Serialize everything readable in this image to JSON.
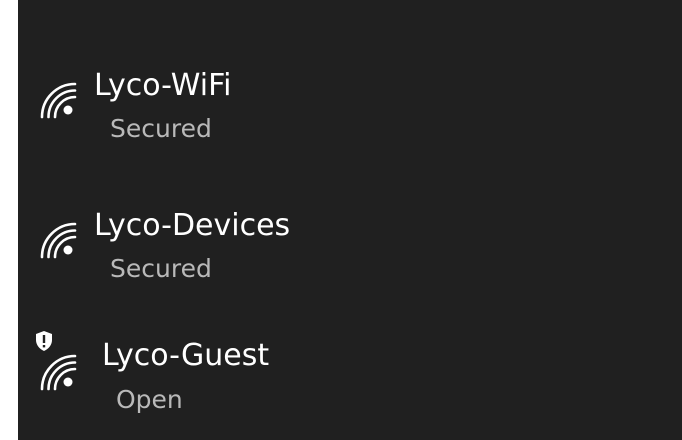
{
  "networks": [
    {
      "ssid": "Lyco-WiFi",
      "status": "Secured",
      "icon": "wifi-signal-icon"
    },
    {
      "ssid": "Lyco-Devices",
      "status": "Secured",
      "icon": "wifi-signal-icon"
    },
    {
      "ssid": "Lyco-Guest",
      "status": "Open",
      "icon": "wifi-signal-icon",
      "warning_icon": "shield-warning-icon"
    }
  ],
  "colors": {
    "background": "#202020",
    "ssid_text": "#ffffff",
    "status_text": "#b9b9b9",
    "icon": "#ffffff"
  }
}
